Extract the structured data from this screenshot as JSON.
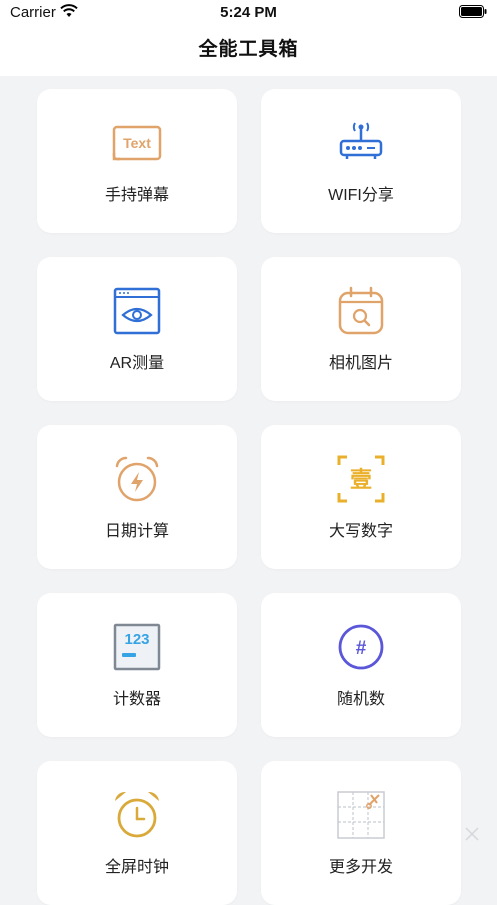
{
  "status_bar": {
    "carrier": "Carrier",
    "time": "5:24 PM"
  },
  "header": {
    "title": "全能工具箱"
  },
  "tools": [
    {
      "label": "手持弹幕",
      "icon": "text-icon",
      "icon_text": "Text"
    },
    {
      "label": "WIFI分享",
      "icon": "router-icon"
    },
    {
      "label": "AR测量",
      "icon": "eye-window-icon"
    },
    {
      "label": "相机图片",
      "icon": "calendar-search-icon"
    },
    {
      "label": "日期计算",
      "icon": "alarm-clock-bolt-icon"
    },
    {
      "label": "大写数字",
      "icon": "chinese-numeral-icon",
      "icon_text": "壹"
    },
    {
      "label": "计数器",
      "icon": "counter-icon",
      "icon_text": "123"
    },
    {
      "label": "随机数",
      "icon": "hash-icon",
      "icon_text": "#"
    },
    {
      "label": "全屏时钟",
      "icon": "alarm-clock-icon"
    },
    {
      "label": "更多开发",
      "icon": "grid-scissors-icon"
    }
  ],
  "colors": {
    "orange": "#e0a36a",
    "blue": "#2f6fd6",
    "yellow": "#eab02b",
    "purple": "#5b57d9",
    "counter_blue": "#36a3e5",
    "gold": "#d9a93a"
  }
}
